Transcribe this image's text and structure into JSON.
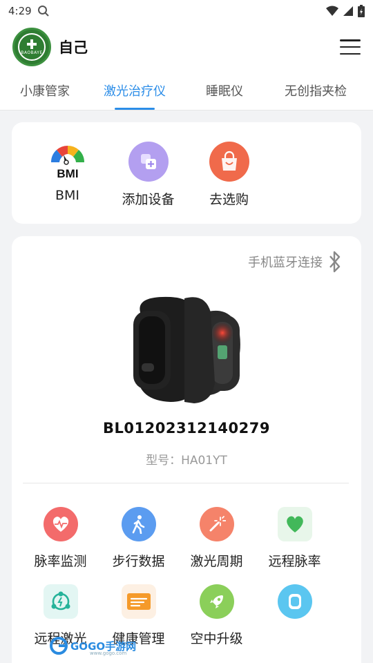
{
  "status": {
    "time": "4:29"
  },
  "header": {
    "user_name": "自己",
    "logo_text": "BAOBAYE"
  },
  "tabs": [
    {
      "label": "小康管家",
      "active": false
    },
    {
      "label": "激光治疗仪",
      "active": true
    },
    {
      "label": "睡眠仪",
      "active": false
    },
    {
      "label": "无创指夹检",
      "active": false
    }
  ],
  "quick_actions": [
    {
      "label": "BMI",
      "icon": "bmi-gauge-icon"
    },
    {
      "label": "添加设备",
      "icon": "add-device-icon"
    },
    {
      "label": "去选购",
      "icon": "shopping-bag-icon"
    }
  ],
  "bmi_icon_text": "BMI",
  "device": {
    "bluetooth_label": "手机蓝牙连接",
    "serial": "BL01202312140279",
    "model": "型号：HA01YT"
  },
  "features": [
    {
      "label": "脉率监测",
      "icon": "heart-pulse-icon"
    },
    {
      "label": "步行数据",
      "icon": "walking-icon"
    },
    {
      "label": "激光周期",
      "icon": "laser-wand-icon"
    },
    {
      "label": "远程脉率",
      "icon": "remote-heart-icon"
    },
    {
      "label": "远程激光",
      "icon": "remote-laser-icon"
    },
    {
      "label": "健康管理",
      "icon": "health-card-icon"
    },
    {
      "label": "空中升级",
      "icon": "rocket-icon"
    },
    {
      "label": "",
      "icon": "watch-icon"
    }
  ],
  "watermark": {
    "text": "GOGO手游网",
    "sub": "www.gogo.com"
  },
  "colors": {
    "accent": "#2b8de8",
    "logo_green": "#2f7d32"
  }
}
